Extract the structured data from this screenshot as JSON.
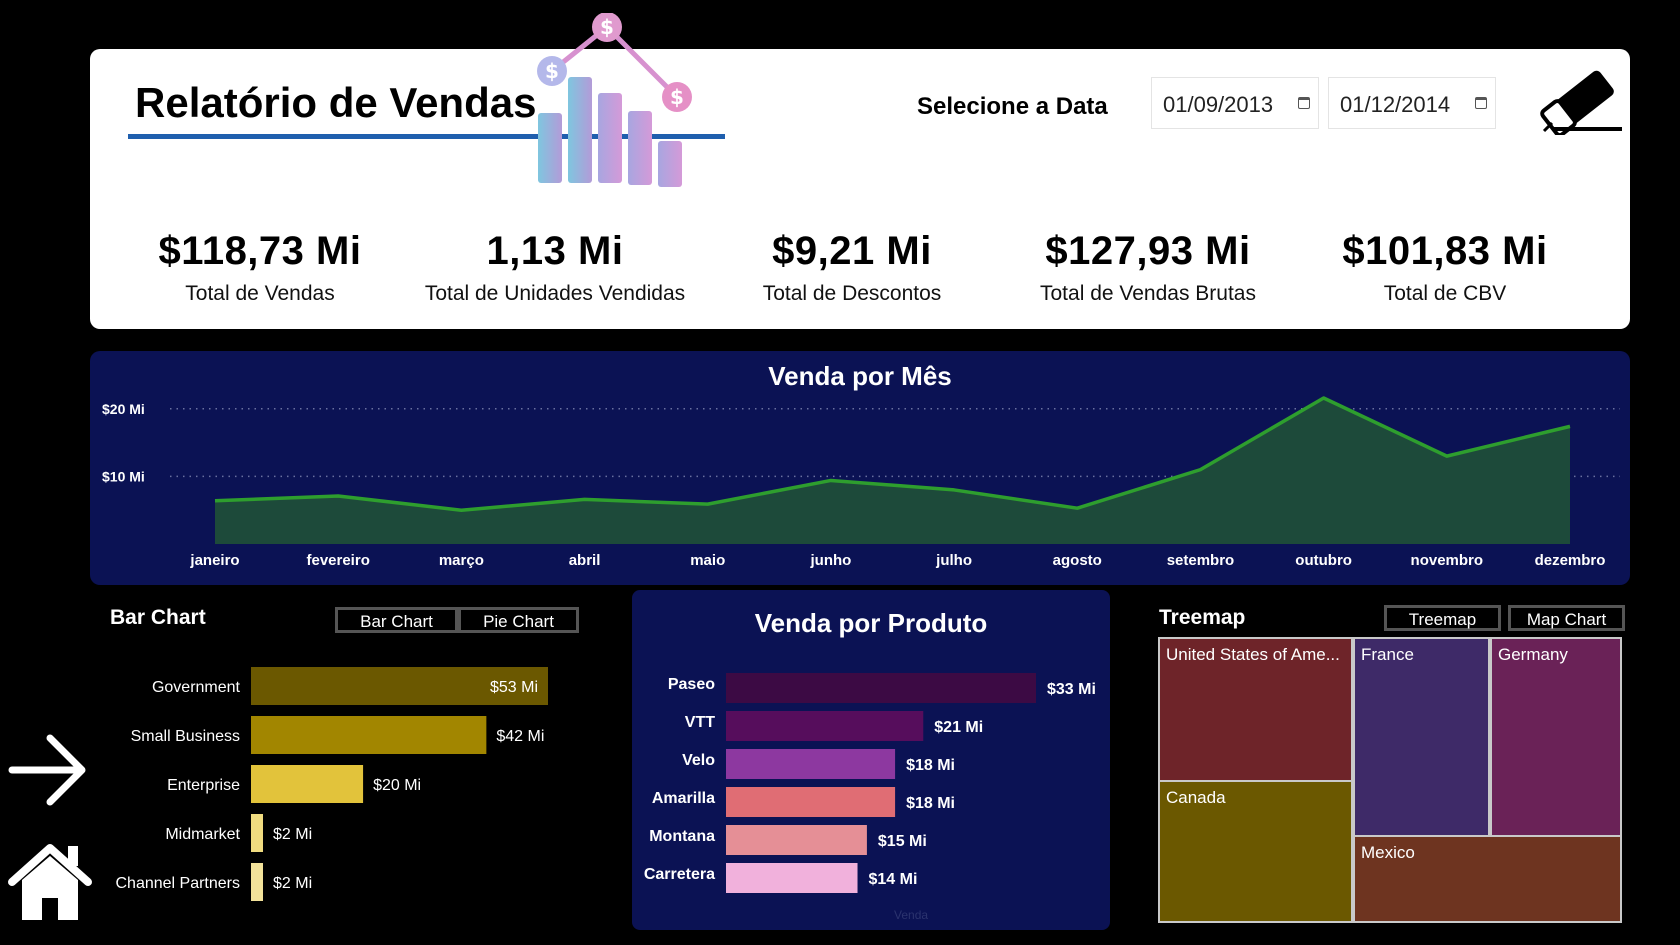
{
  "header": {
    "title": "Relatório de Vendas",
    "date_label": "Selecione a Data",
    "date_start": "01/09/2013",
    "date_end": "01/12/2014",
    "logo_icon": "sales-chart-logo-icon",
    "clear_icon": "eraser-icon"
  },
  "kpis": [
    {
      "value": "$118,73 Mi",
      "label": "Total de Vendas"
    },
    {
      "value": "1,13 Mi",
      "label": "Total de Unidades Vendidas"
    },
    {
      "value": "$9,21 Mi",
      "label": "Total de Descontos"
    },
    {
      "value": "$127,93 Mi",
      "label": "Total de Vendas Brutas"
    },
    {
      "value": "$101,83 Mi",
      "label": "Total de CBV"
    }
  ],
  "bar_section": {
    "title": "Bar Chart",
    "toggle": [
      "Bar Chart",
      "Pie Chart"
    ]
  },
  "treemap_section": {
    "title": "Treemap",
    "toggle": [
      "Treemap",
      "Map Chart"
    ]
  },
  "nav": {
    "next_icon": "arrow-right-icon",
    "home_icon": "home-icon"
  },
  "chart_data": [
    {
      "type": "area",
      "title": "Venda por Mês",
      "categories": [
        "janeiro",
        "fevereiro",
        "março",
        "abril",
        "maio",
        "junho",
        "julho",
        "agosto",
        "setembro",
        "outubro",
        "novembro",
        "dezembro"
      ],
      "values": [
        6.4,
        7.1,
        5.0,
        6.6,
        5.9,
        9.4,
        8.0,
        5.3,
        11.0,
        21.6,
        13.0,
        17.4
      ],
      "y_ticks": [
        {
          "value": 10,
          "label": "$10 Mi"
        },
        {
          "value": 20,
          "label": "$20 Mi"
        }
      ],
      "ylim": [
        0,
        25
      ],
      "grid": true,
      "color": "#2e9e2e",
      "fill": "#1d4a3a"
    },
    {
      "type": "bar",
      "orientation": "horizontal",
      "categories": [
        "Government",
        "Small Business",
        "Enterprise",
        "Midmarket",
        "Channel Partners"
      ],
      "values": [
        53,
        42,
        20,
        2,
        2
      ],
      "data_labels": [
        "$53 Mi",
        "$42 Mi",
        "$20 Mi",
        "$2 Mi",
        "$2 Mi"
      ],
      "colors": [
        "#6b5800",
        "#a28600",
        "#e2c33b",
        "#f0dc80",
        "#f3e29a"
      ]
    },
    {
      "type": "bar",
      "orientation": "horizontal",
      "title": "Venda por Produto",
      "categories": [
        "Paseo",
        "VTT",
        "Velo",
        "Amarilla",
        "Montana",
        "Carretera"
      ],
      "values": [
        33,
        21,
        18,
        18,
        15,
        14
      ],
      "data_labels": [
        "$33 Mi",
        "$21 Mi",
        "$18 Mi",
        "$18 Mi",
        "$15 Mi",
        "$14 Mi"
      ],
      "colors": [
        "#3c0a44",
        "#560d5c",
        "#8d38a0",
        "#e06d74",
        "#e58f96",
        "#f1b1dc"
      ],
      "xlabel": "Venda"
    },
    {
      "type": "treemap",
      "items": [
        {
          "label": "United States of Ame...",
          "color": "#6e2429"
        },
        {
          "label": "France",
          "color": "#3e2a68"
        },
        {
          "label": "Germany",
          "color": "#6a2257"
        },
        {
          "label": "Canada",
          "color": "#6b5800"
        },
        {
          "label": "Mexico",
          "color": "#6e3420"
        }
      ]
    }
  ]
}
